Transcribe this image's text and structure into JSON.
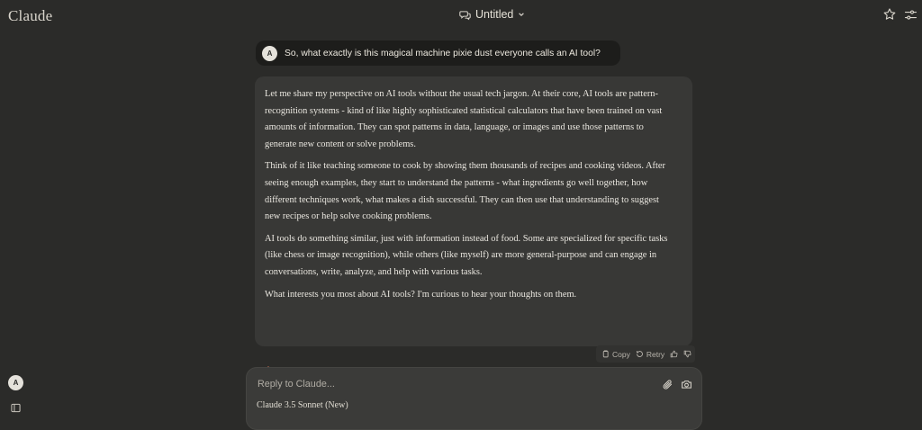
{
  "app": {
    "brand": "Claude"
  },
  "header": {
    "title": "Untitled",
    "chat_icon": "chat-bubbles-icon",
    "chevron_icon": "chevron-down-icon",
    "star_icon": "star-icon",
    "settings_icon": "sliders-icon"
  },
  "user_message": {
    "avatar_initial": "A",
    "text": "So, what exactly is this magical machine pixie dust everyone calls an AI tool?"
  },
  "assistant_message": {
    "paragraphs": [
      "Let me share my perspective on AI tools without the usual tech jargon. At their core, AI tools are pattern-recognition systems - kind of like highly sophisticated statistical calculators that have been trained on vast amounts of information. They can spot patterns in data, language, or images and use those patterns to generate new content or solve problems.",
      "Think of it like teaching someone to cook by showing them thousands of recipes and cooking videos. After seeing enough examples, they start to understand the patterns - what ingredients go well together, how different techniques work, what makes a dish successful. They can then use that understanding to suggest new recipes or help solve cooking problems.",
      "AI tools do something similar, just with information instead of food. Some are specialized for specific tasks (like chess or image recognition), while others (like myself) are more general-purpose and can engage in conversations, write, analyze, and help with various tasks.",
      "What interests you most about AI tools? I'm curious to hear your thoughts on them."
    ]
  },
  "message_actions": {
    "copy_label": "Copy",
    "retry_label": "Retry",
    "thumbs_up_icon": "thumbs-up-icon",
    "thumbs_down_icon": "thumbs-down-icon"
  },
  "composer": {
    "placeholder": "Reply to Claude...",
    "model": "Claude 3.5 Sonnet (New)",
    "attach_icon": "paperclip-icon",
    "camera_icon": "camera-icon"
  },
  "sidebar": {
    "avatar_initial": "A",
    "toggle_icon": "sidebar-toggle-icon"
  },
  "colors": {
    "background": "#2b2b29",
    "user_bubble": "#1d1d1b",
    "assistant_bubble": "#383836",
    "composer": "#3b3b39",
    "accent": "#d97757"
  }
}
